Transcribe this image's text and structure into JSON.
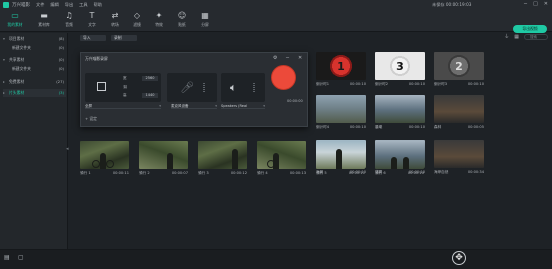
{
  "titlebar": {
    "app_title": "万兴喵影",
    "menu": [
      "文件",
      "编辑",
      "导出",
      "工具",
      "帮助"
    ],
    "save_status": "未保存 00:00:19:03",
    "window_buttons": [
      "─",
      "□",
      "✕"
    ]
  },
  "toolbar": {
    "items": [
      {
        "label": "我的素材",
        "icon": "media-icon",
        "glyph": "▭",
        "active": true
      },
      {
        "label": "素材库",
        "icon": "folder-icon",
        "glyph": "▬",
        "active": false
      },
      {
        "label": "音频",
        "icon": "music-icon",
        "glyph": "♫",
        "active": false
      },
      {
        "label": "文字",
        "icon": "text-icon",
        "glyph": "T",
        "active": false
      },
      {
        "label": "转场",
        "icon": "transition-icon",
        "glyph": "⇄",
        "active": false
      },
      {
        "label": "滤镜",
        "icon": "filter-icon",
        "glyph": "◇",
        "active": false
      },
      {
        "label": "特效",
        "icon": "effect-icon",
        "glyph": "✦",
        "active": false
      },
      {
        "label": "贴纸",
        "icon": "sticker-icon",
        "glyph": "☺",
        "active": false
      },
      {
        "label": "分屏",
        "icon": "split-screen-icon",
        "glyph": "▦",
        "active": false
      }
    ],
    "export_label": "导出视频"
  },
  "sidebar": {
    "items": [
      {
        "label": "项目素材",
        "count": "(8)",
        "level": 0,
        "active": false
      },
      {
        "label": "新建文件夹",
        "count": "(0)",
        "level": 1,
        "active": false
      },
      {
        "label": "共享素材",
        "count": "(0)",
        "level": 0,
        "active": false
      },
      {
        "label": "新建文件夹",
        "count": "(0)",
        "level": 1,
        "active": false
      },
      {
        "label": "免费素材",
        "count": "(27)",
        "level": 0,
        "active": false
      },
      {
        "label": "片头素材",
        "count": "(3)",
        "level": 0,
        "active": true
      }
    ]
  },
  "media_header": {
    "import_label": "导入",
    "record_label": "录制",
    "search_placeholder": "搜索"
  },
  "recorder": {
    "title": "万兴喵影录屏",
    "width": "2560",
    "height": "1440",
    "fps_label": "帧",
    "width_label": "宽",
    "height_label": "高",
    "region_select": "全屏",
    "mic_select": "麦克风设备",
    "speaker_select": "Speakers (Real",
    "timer": "00:00:00",
    "settings_label": "+ 设定"
  },
  "clips_right": [
    {
      "name": "倒计时1",
      "duration": "00:00:10",
      "kind": "countdown-red",
      "num": "1"
    },
    {
      "name": "倒计时2",
      "duration": "00:00:10",
      "kind": "countdown-white",
      "num": "3"
    },
    {
      "name": "倒计时3",
      "duration": "00:00:10",
      "kind": "countdown-gray",
      "num": "2"
    },
    {
      "name": "倒计时4",
      "duration": "00:00:10",
      "kind": "road"
    },
    {
      "name": "晨曦",
      "duration": "00:00:10",
      "kind": "lake"
    },
    {
      "name": "森林",
      "duration": "00:00:05",
      "kind": "dark"
    },
    {
      "name": "海景",
      "duration": "00:00:10",
      "kind": "bright"
    },
    {
      "name": "薄雾",
      "duration": "00:00:10",
      "kind": "lake"
    },
    {
      "name": "海岸自然",
      "duration": "00:00:34",
      "kind": "dark"
    }
  ],
  "clips_bottom": [
    {
      "name": "骑行 1",
      "duration": "00:00:11",
      "kind": "forest"
    },
    {
      "name": "骑行 2",
      "duration": "00:00:07",
      "kind": "forest2"
    },
    {
      "name": "骑行 3",
      "duration": "00:00:12",
      "kind": "forest"
    },
    {
      "name": "骑行 4",
      "duration": "00:00:13",
      "kind": "forest2"
    },
    {
      "name": "骑行 5",
      "duration": "00:00:11",
      "kind": "bright"
    },
    {
      "name": "骑行 6",
      "duration": "00:00:10",
      "kind": "lake"
    }
  ]
}
